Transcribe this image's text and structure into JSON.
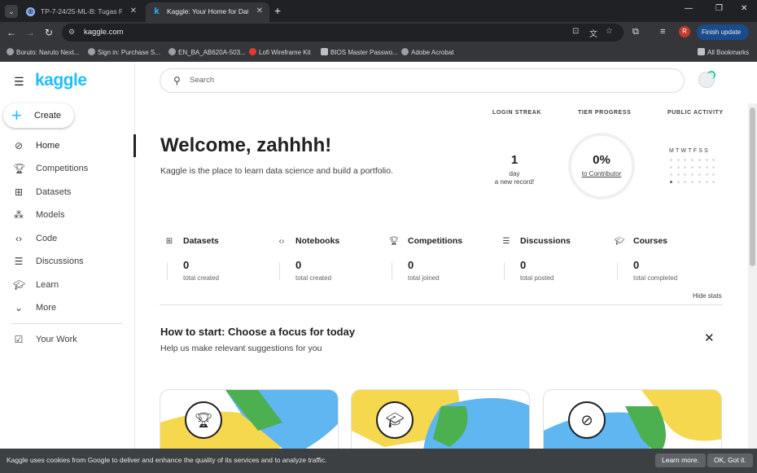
{
  "browser": {
    "tabs": [
      {
        "title": "TP-7-24/25-ML-B: Tugas Perte",
        "active": false
      },
      {
        "title": "Kaggle: Your Home for Data Sc",
        "active": true
      }
    ],
    "new_tab": "+",
    "url": "kaggle.com",
    "profile_initial": "R",
    "finish_update": "Finish update",
    "bookmarks": [
      "Boruto: Naruto Next...",
      "Sign in: Purchase S...",
      "EN_BA_AB620A-503...",
      "Lofi Wireframe Kit",
      "BIOS Master Passwo...",
      "Adobe Acrobat"
    ],
    "all_bookmarks": "All Bookmarks"
  },
  "sidebar": {
    "logo": "kaggle",
    "create_label": "Create",
    "items": [
      {
        "label": "Home",
        "icon": "compass-icon",
        "active": true
      },
      {
        "label": "Competitions",
        "icon": "trophy-icon",
        "active": false
      },
      {
        "label": "Datasets",
        "icon": "table-icon",
        "active": false
      },
      {
        "label": "Models",
        "icon": "models-icon",
        "active": false
      },
      {
        "label": "Code",
        "icon": "code-icon",
        "active": false
      },
      {
        "label": "Discussions",
        "icon": "discussion-icon",
        "active": false
      },
      {
        "label": "Learn",
        "icon": "graduation-cap-icon",
        "active": false
      },
      {
        "label": "More",
        "icon": "chevron-down-icon",
        "active": false
      }
    ],
    "your_work": "Your Work"
  },
  "search": {
    "placeholder": "Search"
  },
  "welcome": {
    "title": "Welcome, zahhhh!",
    "subtitle": "Kaggle is the place to learn data science and build a portfolio."
  },
  "progress": {
    "login_streak": {
      "header": "LOGIN STREAK",
      "value": "1",
      "unit": "day",
      "record": "a new record!"
    },
    "tier": {
      "header": "TIER PROGRESS",
      "value": "0%",
      "label": "to Contributor",
      "fraction": 0
    },
    "activity": {
      "header": "PUBLIC ACTIVITY",
      "days": "MTWTFSS"
    }
  },
  "stats": [
    {
      "label": "Datasets",
      "value": "0",
      "caption": "total created"
    },
    {
      "label": "Notebooks",
      "value": "0",
      "caption": "total created"
    },
    {
      "label": "Competitions",
      "value": "0",
      "caption": "total joined"
    },
    {
      "label": "Discussions",
      "value": "0",
      "caption": "total posted"
    },
    {
      "label": "Courses",
      "value": "0",
      "caption": "total completed"
    }
  ],
  "hide_stats": "Hide stats",
  "howto": {
    "title": "How to start: Choose a focus for today",
    "subtitle": "Help us make relevant suggestions for you"
  },
  "cookie": {
    "text": "Kaggle uses cookies from Google to deliver and enhance the quality of its services and to analyze traffic.",
    "learn_more": "Learn more.",
    "ok": "OK, Got it."
  },
  "colors": {
    "accent": "#20beff",
    "card_yellow": "#f5d84e",
    "card_green": "#4caf50",
    "card_blue": "#5fb6f0"
  }
}
